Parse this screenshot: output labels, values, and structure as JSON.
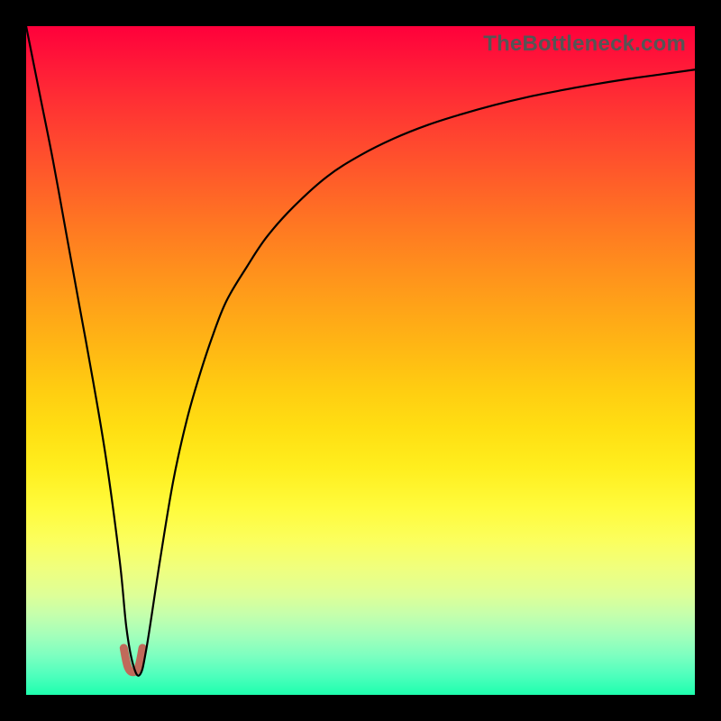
{
  "watermark": "TheBottleneck.com",
  "chart_data": {
    "type": "line",
    "title": "",
    "xlabel": "",
    "ylabel": "",
    "xlim": [
      0,
      100
    ],
    "ylim": [
      0,
      100
    ],
    "grid": false,
    "background_gradient": {
      "direction": "vertical",
      "stops": [
        {
          "pos": 0.0,
          "color": "#ff003b"
        },
        {
          "pos": 0.5,
          "color": "#ffc214"
        },
        {
          "pos": 0.75,
          "color": "#fcff52"
        },
        {
          "pos": 1.0,
          "color": "#1effae"
        }
      ]
    },
    "series": [
      {
        "name": "main-curve",
        "color": "#000000",
        "width": 2.2,
        "x": [
          0,
          2,
          4,
          6,
          8,
          10,
          12,
          14,
          15,
          16,
          17,
          18,
          20,
          22,
          24,
          26,
          28,
          30,
          33,
          36,
          40,
          45,
          50,
          55,
          60,
          65,
          70,
          75,
          80,
          85,
          90,
          95,
          100
        ],
        "y": [
          100,
          90,
          80,
          69,
          58,
          47,
          35,
          20,
          10,
          4.5,
          3.0,
          7,
          20,
          32,
          41,
          48,
          54,
          59,
          64,
          68.5,
          73,
          77.5,
          80.7,
          83.2,
          85.2,
          86.8,
          88.2,
          89.4,
          90.4,
          91.3,
          92.1,
          92.8,
          93.5
        ]
      },
      {
        "name": "tip-marker",
        "color": "#c06a5a",
        "width": 9,
        "linecap": "round",
        "x": [
          14.6,
          15.2,
          16.0,
          16.8,
          17.4
        ],
        "y": [
          7.0,
          4.2,
          3.4,
          4.2,
          7.0
        ]
      }
    ],
    "minimum": {
      "x": 16.0,
      "y": 3.0
    }
  }
}
